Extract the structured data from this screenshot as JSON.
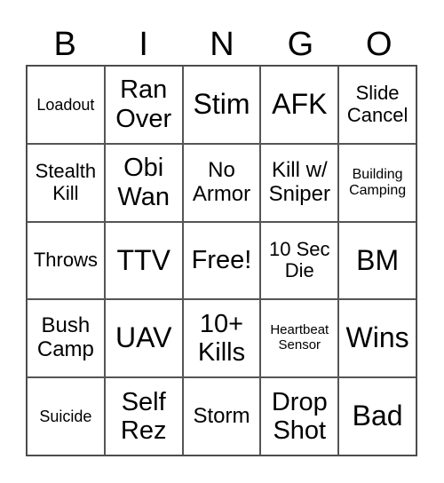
{
  "header": [
    "B",
    "I",
    "N",
    "G",
    "O"
  ],
  "cells": [
    [
      "Loadout",
      "Ran Over",
      "Stim",
      "AFK",
      "Slide Cancel"
    ],
    [
      "Stealth Kill",
      "Obi Wan",
      "No Armor",
      "Kill w/ Sniper",
      "Building Camping"
    ],
    [
      "Throws",
      "TTV",
      "Free!",
      "10 Sec Die",
      "BM"
    ],
    [
      "Bush Camp",
      "UAV",
      "10+ Kills",
      "Heartbeat Sensor",
      "Wins"
    ],
    [
      "Suicide",
      "Self Rez",
      "Storm",
      "Drop Shot",
      "Bad"
    ]
  ]
}
